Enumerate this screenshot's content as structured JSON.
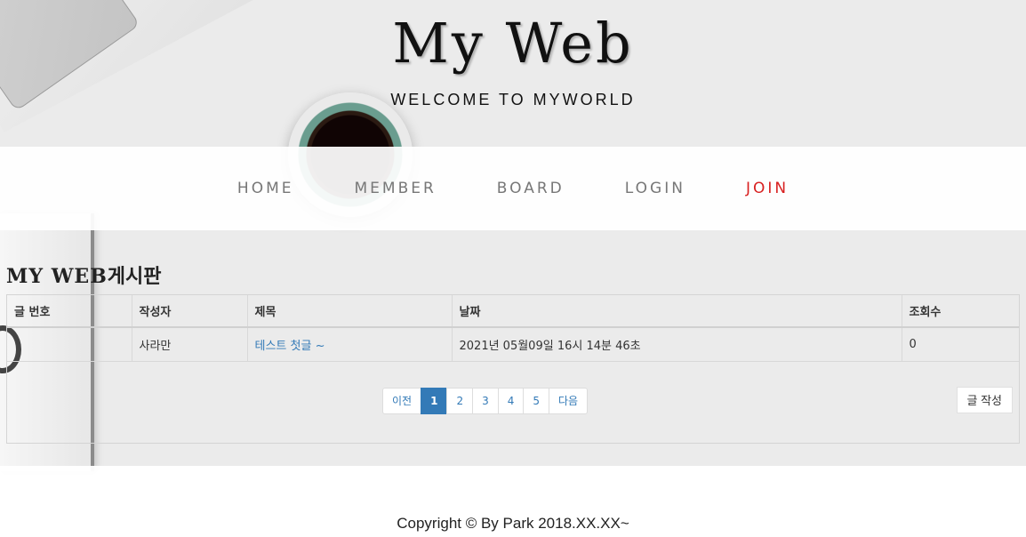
{
  "header": {
    "title": "My Web",
    "subtitle": "WELCOME TO MYWORLD"
  },
  "nav": {
    "items": [
      {
        "label": "HOME"
      },
      {
        "label": "MEMBER"
      },
      {
        "label": "BOARD"
      },
      {
        "label": "LOGIN"
      },
      {
        "label": "JOIN"
      }
    ],
    "active_color": "#d82020"
  },
  "board": {
    "title_en": "MY WEB",
    "title_ko": "게시판",
    "columns": [
      "글 번호",
      "작성자",
      "제목",
      "날짜",
      "조회수"
    ],
    "rows": [
      {
        "no": "",
        "author": "사라만",
        "subject": "테스트 첫글 ~",
        "date": "2021년 05월09일 16시 14분 46초",
        "views": "0"
      }
    ],
    "pagination": {
      "prev": "이전",
      "pages": [
        "1",
        "2",
        "3",
        "4",
        "5"
      ],
      "next": "다음",
      "current": "1"
    },
    "write_label": "글 작성"
  },
  "footer": {
    "copyright": "Copyright © By Park 2018.XX.XX~"
  },
  "colors": {
    "link": "#337ab7",
    "accent": "#d82020"
  }
}
